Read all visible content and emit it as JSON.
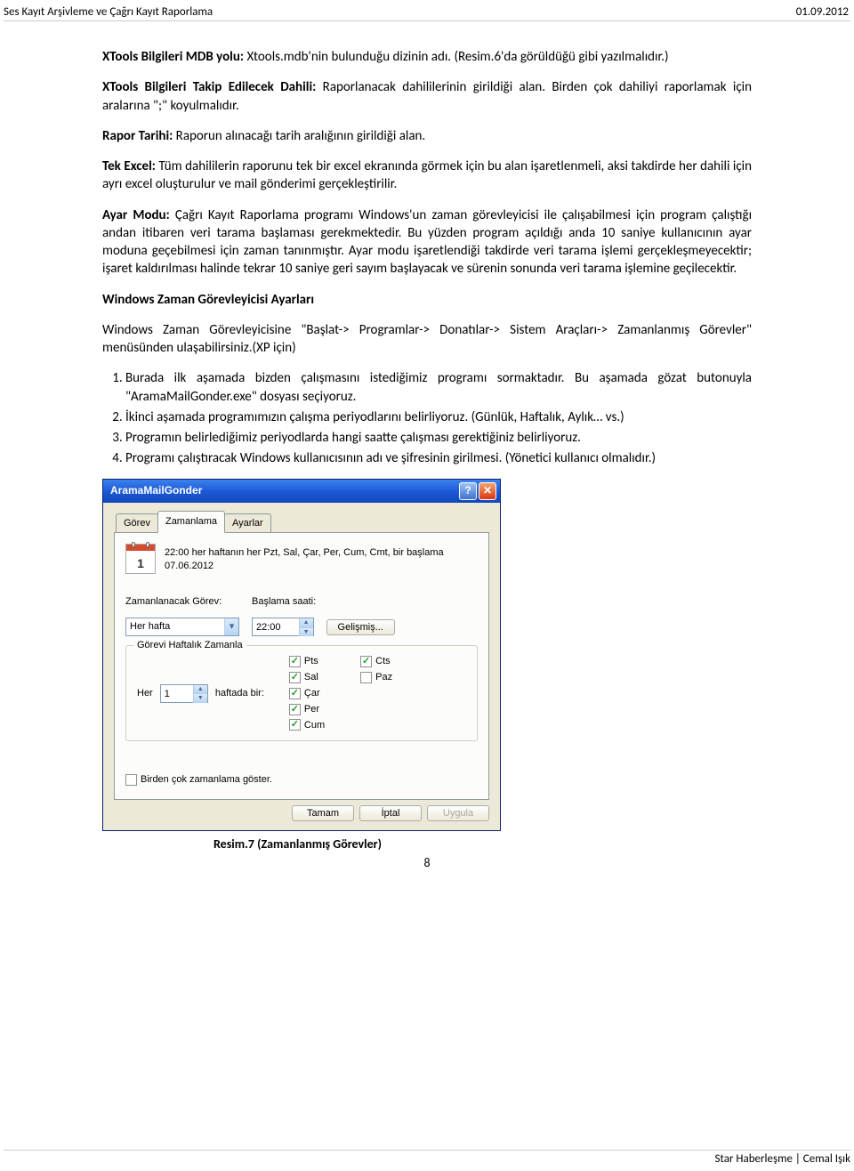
{
  "header": {
    "left": "Ses Kayıt Arşivleme ve Çağrı Kayıt Raporlama",
    "right": "01.09.2012"
  },
  "p1": {
    "b": "XTools Bilgileri MDB yolu: ",
    "t": "      Xtools.mdb'nin bulunduğu dizinin adı. (Resim.6'da görüldüğü gibi yazılmalıdır.)"
  },
  "p2": {
    "b": "XTools Bilgileri Takip Edilecek Dahili: ",
    "t": "Raporlanacak dahililerinin girildiği alan. Birden çok dahiliyi raporlamak için aralarına \";\" koyulmalıdır."
  },
  "p3": {
    "b": "Rapor Tarihi: ",
    "t": "Raporun alınacağı tarih aralığının girildiği alan."
  },
  "p4": {
    "b": "Tek Excel: ",
    "t": "Tüm dahililerin raporunu tek bir excel ekranında görmek için bu alan işaretlenmeli, aksi takdirde her dahili için ayrı excel oluşturulur ve mail gönderimi gerçekleştirilir."
  },
  "p5": {
    "b": "Ayar Modu: ",
    "t": "     Çağrı Kayıt Raporlama programı Windows'un zaman görevleyicisi ile çalışabilmesi için program çalıştığı andan itibaren veri tarama başlaması gerekmektedir. Bu yüzden program açıldığı anda 10 saniye kullanıcının ayar moduna geçebilmesi için zaman tanınmıştır. Ayar modu işaretlendiği takdirde veri tarama işlemi gerçekleşmeyecektir; işaret kaldırılması halinde tekrar 10 saniye geri sayım başlayacak ve sürenin sonunda veri tarama işlemine geçilecektir."
  },
  "h2": "Windows Zaman Görevleyicisi Ayarları",
  "p6": "Windows Zaman Görevleyicisine \"Başlat-> Programlar-> Donatılar-> Sistem Araçları-> Zamanlanmış Görevler\" menüsünden ulaşabilirsiniz.(XP için)",
  "steps": [
    "Burada ilk aşamada bizden çalışmasını istediğimiz programı sormaktadır. Bu aşamada gözat butonuyla \"AramaMailGonder.exe\" dosyası seçiyoruz.",
    "İkinci aşamada programımızın çalışma periyodlarını belirliyoruz.  (Günlük, Haftalık, Aylık… vs.)",
    "Programın belirlediğimiz periyodlarda hangi saatte çalışması gerektiğiniz belirliyoruz.",
    "Programı çalıştıracak Windows kullanıcısının adı ve şifresinin girilmesi. (Yönetici kullanıcı olmalıdır.)"
  ],
  "dialog": {
    "title": "AramaMailGonder",
    "tabs": {
      "t0": "Görev",
      "t1": "Zamanlama",
      "t2": "Ayarlar"
    },
    "summary": "22:00 her haftanın her Pzt, Sal, Çar, Per, Cum, Cmt, bir başlama 07.06.2012",
    "labels": {
      "task": "Zamanlanacak Görev:",
      "start": "Başlama saati:"
    },
    "task_select": "Her hafta",
    "start_time": "22:00",
    "advanced_btn": "Gelişmiş...",
    "fieldset_legend": "Görevi Haftalık Zamanla",
    "every_label": "Her",
    "every_value": "1",
    "weeks_label": "haftada bir:",
    "days": {
      "pzt": "Pts",
      "sal": "Sal",
      "car": "Çar",
      "per": "Per",
      "cum": "Cum",
      "cts": "Cts",
      "paz": "Paz"
    },
    "multi_schedule": "Birden çok zamanlama göster.",
    "ok": "Tamam",
    "cancel": "İptal",
    "apply": "Uygula"
  },
  "figcaption": "Resim.7 (Zamanlanmış Görevler)",
  "page_number": "8",
  "footer": "Star Haberleşme | Cemal Işık"
}
